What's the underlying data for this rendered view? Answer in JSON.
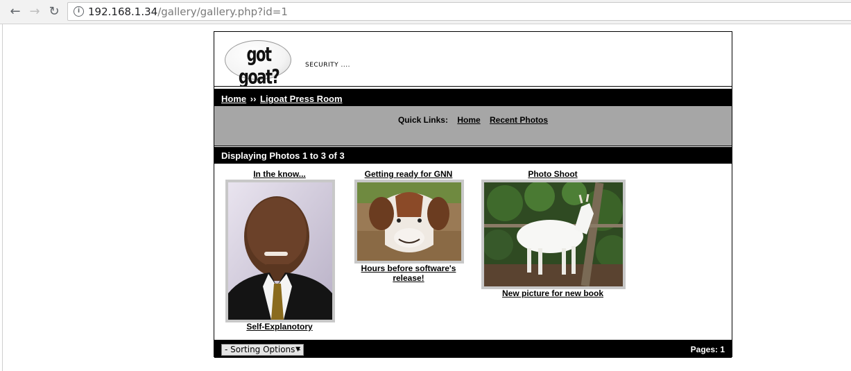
{
  "browser": {
    "back_icon": "arrow-left-icon",
    "forward_icon": "arrow-right-icon",
    "reload_icon": "reload-icon",
    "url_host": "192.168.1.34",
    "url_path": "/gallery/gallery.php?id=1"
  },
  "header": {
    "logo_text": "got goat?",
    "tagline": "SECURITY ...."
  },
  "breadcrumb": {
    "home": "Home",
    "separator": "››",
    "current": "Ligoat Press Room"
  },
  "quick_links": {
    "label": "Quick Links:",
    "items": [
      "Home",
      "Recent Photos"
    ]
  },
  "display": {
    "text": "Displaying Photos 1 to 3 of 3"
  },
  "photos": [
    {
      "title": "In the know...",
      "caption": "Self-Explanotory",
      "image": "portrait-photo"
    },
    {
      "title": "Getting ready for GNN",
      "caption": "Hours before software's release!",
      "image": "goat-closeup-photo"
    },
    {
      "title": "Photo Shoot",
      "caption": "New picture for new book",
      "image": "white-goat-photo"
    }
  ],
  "footer": {
    "sort_label": "- Sorting Options -",
    "pages_label": "Pages: 1"
  },
  "colors": {
    "bar": "#000000",
    "quick_links_bg": "#a6a6a6",
    "frame": "#c8c8c8"
  }
}
